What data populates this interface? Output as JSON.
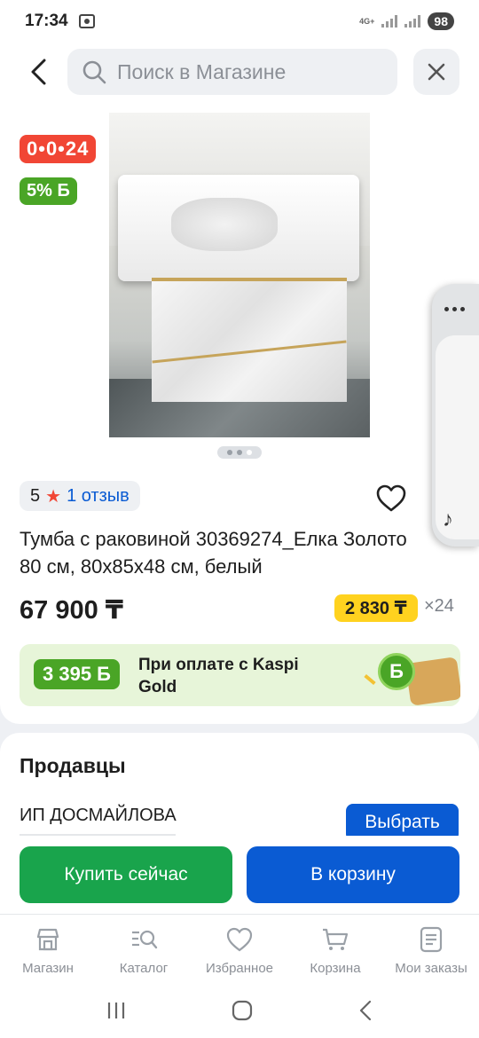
{
  "status_bar": {
    "time": "17:34",
    "network": "4G+",
    "battery": "98"
  },
  "search": {
    "placeholder": "Поиск в Магазине"
  },
  "product": {
    "badge_installment": "0•0•24",
    "badge_bonus": "5% Б",
    "rating": "5",
    "reviews_label": "1 отзыв",
    "title": "Тумба с раковиной 30369274_Елка Золото 80 см, 80x85x48 см, белый",
    "price": "67 900 ₸",
    "monthly_price": "2 830 ₸",
    "monthly_multiplier": "×24",
    "gallery_pages": 3,
    "gallery_active": 3
  },
  "kaspi_gold": {
    "bonus": "3 395 Б",
    "text": "При оплате с Kaspi Gold",
    "coin_symbol": "Б"
  },
  "sellers": {
    "title": "Продавцы",
    "seller_name": "ИП ДОСМАЙЛОВА",
    "choose_label": "Выбрать"
  },
  "actions": {
    "buy_now": "Купить сейчас",
    "add_to_cart": "В корзину"
  },
  "bottom_nav": {
    "items": [
      {
        "label": "Магазин",
        "icon": "store-icon"
      },
      {
        "label": "Каталог",
        "icon": "catalog-icon"
      },
      {
        "label": "Избранное",
        "icon": "heart-icon"
      },
      {
        "label": "Корзина",
        "icon": "cart-icon"
      },
      {
        "label": "Мои заказы",
        "icon": "orders-icon"
      }
    ]
  },
  "colors": {
    "primary_blue": "#0a5bd3",
    "buy_green": "#19a44c",
    "bonus_green": "#4aa526",
    "installment_red": "#f14635",
    "monthly_yellow": "#ffd21f"
  }
}
